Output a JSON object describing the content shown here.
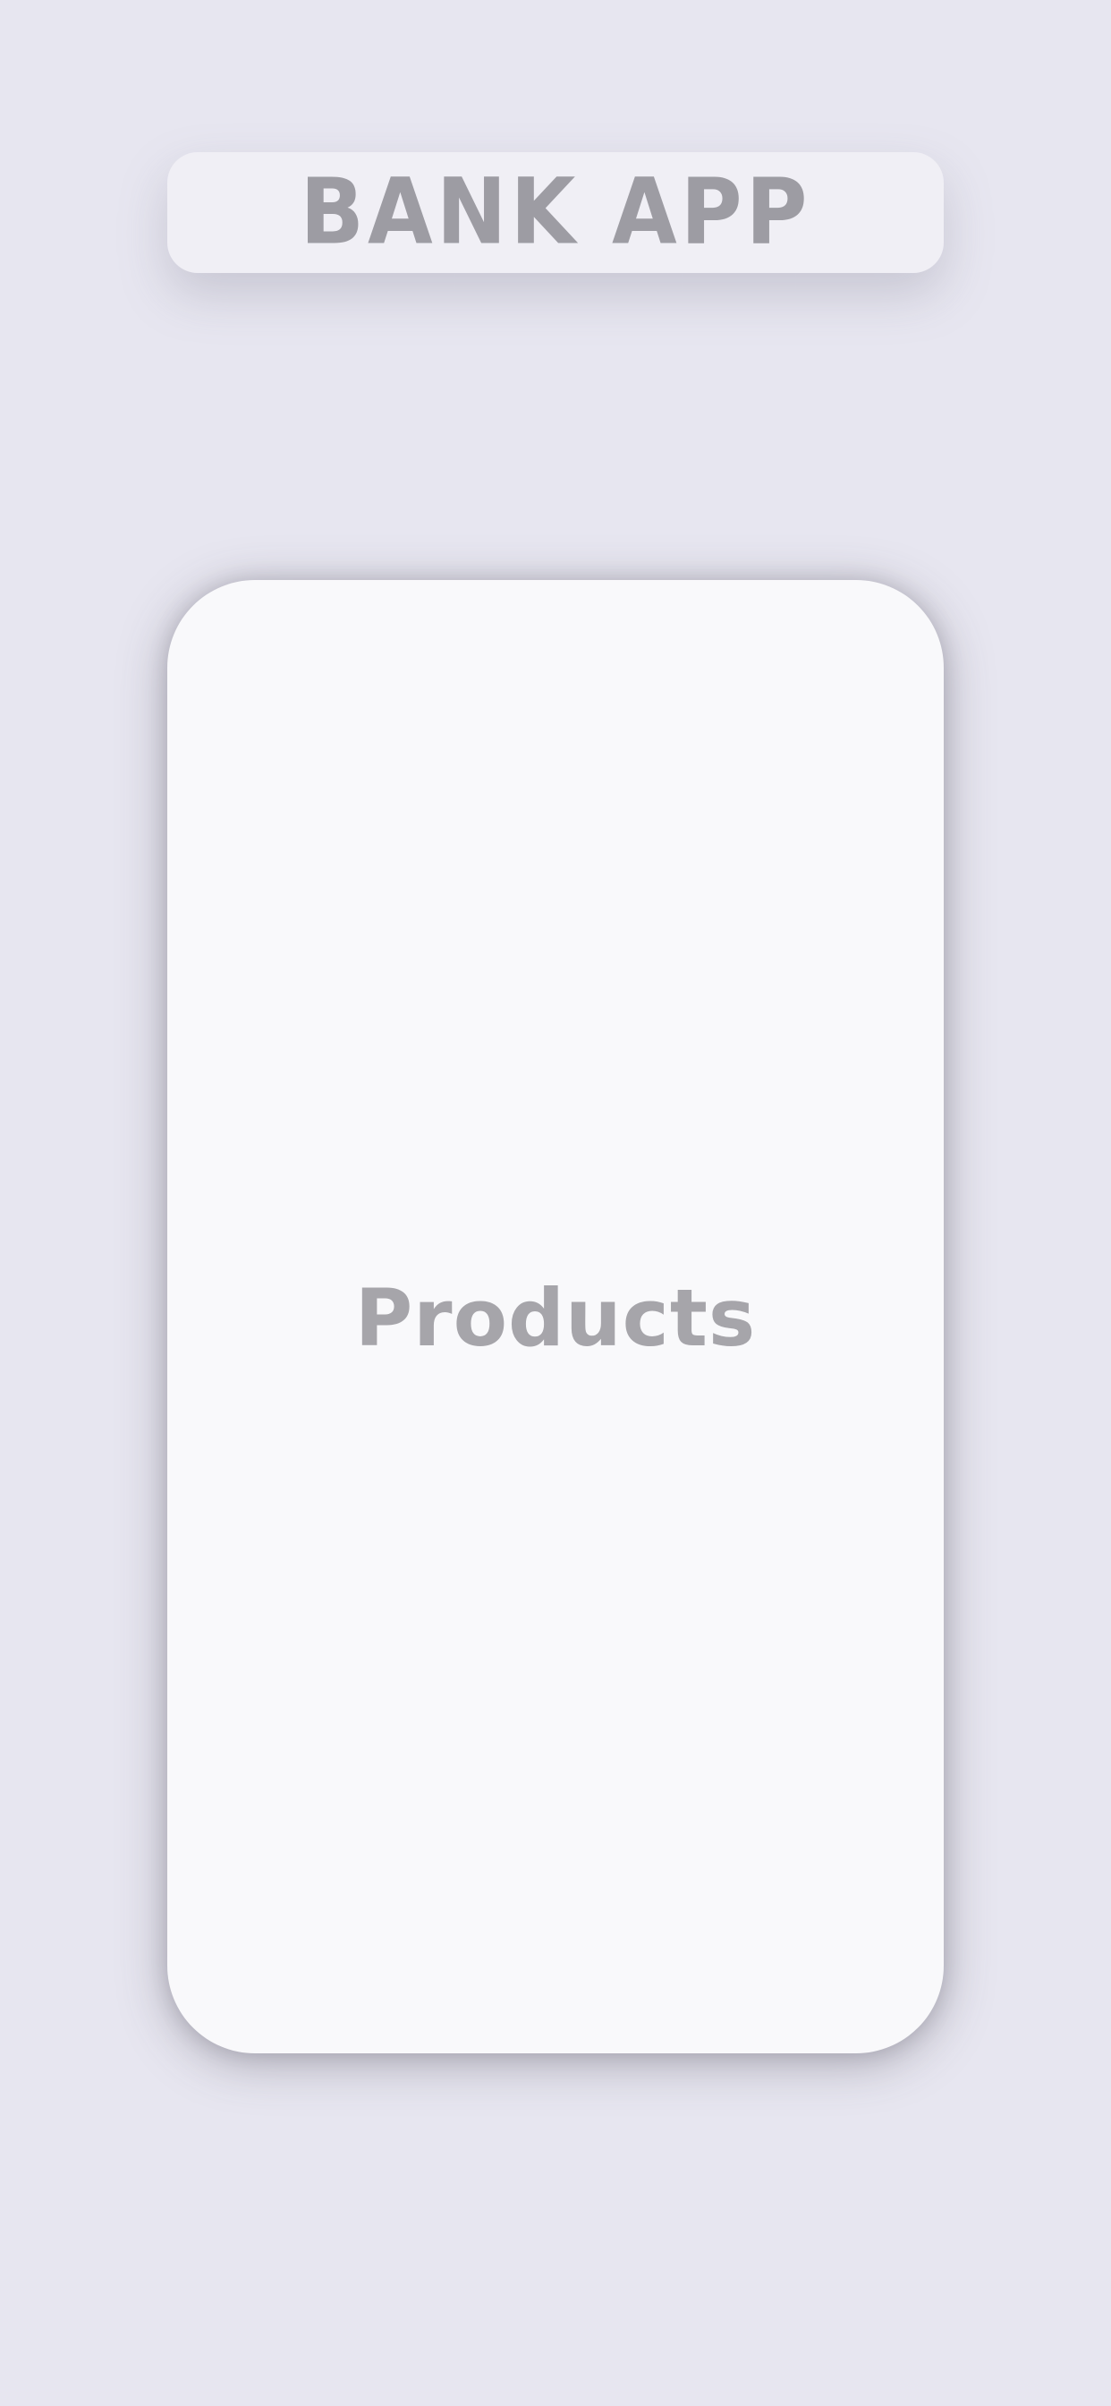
{
  "header": {
    "title": "BANK APP"
  },
  "main": {
    "section_label": "Products"
  },
  "colors": {
    "background": "#e7e6f0",
    "header_card": "#f0eff5",
    "content_card": "#f9f9fb",
    "title_text": "#9d9ca3",
    "section_text": "#a6a5aa"
  }
}
